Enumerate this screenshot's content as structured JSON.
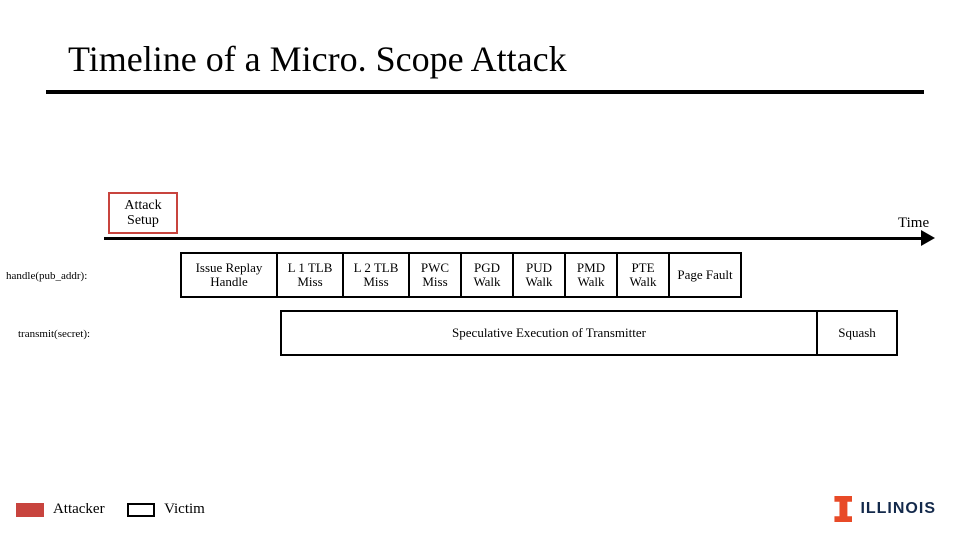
{
  "title": "Timeline of a Micro. Scope Attack",
  "attack_setup": "Attack Setup",
  "time_label": "Time",
  "row_labels": {
    "handle": "handle(pub_addr):",
    "transmit": "transmit(secret):"
  },
  "row1": {
    "issue": "Issue Replay Handle",
    "l1tlb": "L 1 TLB Miss",
    "l2tlb": "L 2 TLB Miss",
    "pwc": "PWC Miss",
    "pgd": "PGD Walk",
    "pud": "PUD Walk",
    "pmd": "PMD Walk",
    "pte": "PTE Walk",
    "pagefault": "Page Fault"
  },
  "row2": {
    "spec": "Speculative Execution of Transmitter",
    "squash": "Squash"
  },
  "legend": {
    "attacker": "Attacker",
    "victim": "Victim"
  },
  "logo_text": "ILLINOIS"
}
